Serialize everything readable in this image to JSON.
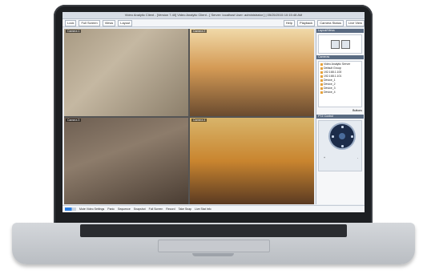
{
  "window": {
    "title": "Video Analytic Client - [Version 7.40] Video Analytic Client - [ Server: localhost User: administrator ] | 05/25/2015 10:15:48 AM"
  },
  "menubar": {
    "left_items": [
      "Lock",
      "Full Screen",
      "Views",
      "Layout"
    ],
    "right_items": [
      "Help",
      "Playback",
      "Camera Status",
      "Live View"
    ]
  },
  "cameras": [
    {
      "label": "Camera 1"
    },
    {
      "label": "Camera 2"
    },
    {
      "label": "Camera 3"
    },
    {
      "label": "Camera 4"
    }
  ],
  "sidebar": {
    "layout_header": "Layout/Views",
    "camera_header": "Cameras",
    "tree": [
      "Video Analytic Server",
      "Default Group",
      "192.168.1.100",
      "192.168.1.101",
      "Device_1",
      "Device_2",
      "Device_3",
      "Device_4"
    ],
    "buttons_label": "Buttons",
    "ptz_header": "PTZ Control",
    "ptz_zoom_in": "+",
    "ptz_zoom_out": "-"
  },
  "statusbar": {
    "items": [
      "Mute Video Settings",
      "Panic",
      "Sequence",
      "Snapshot",
      "Full Screen",
      "Record",
      "Take Snap",
      "Live Stat Info"
    ]
  },
  "colors": {
    "accent": "#5a6b82",
    "ptz": "#1c2c4a"
  }
}
